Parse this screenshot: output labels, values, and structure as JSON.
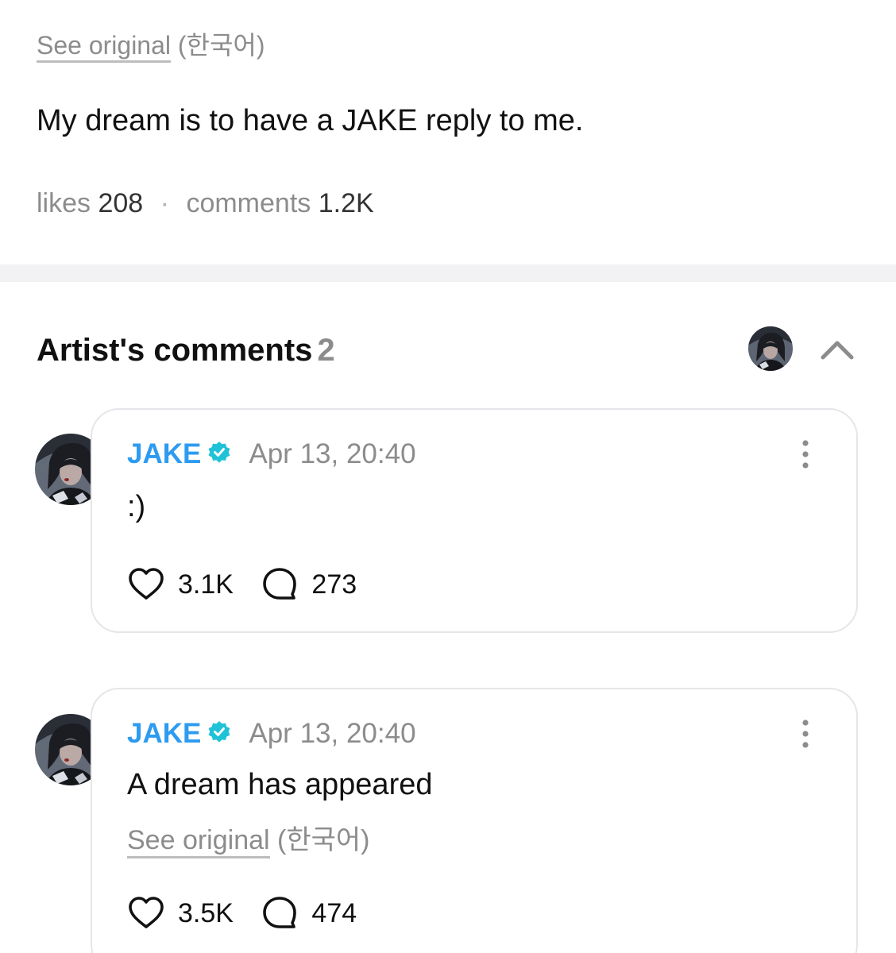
{
  "post": {
    "see_original_label": "See original",
    "language_note": "(한국어)",
    "text": "My dream is to have a JAKE reply to me.",
    "likes_label": "likes",
    "likes_count": "208",
    "separator": "·",
    "comments_label": "comments",
    "comments_count": "1.2K"
  },
  "artist_comments": {
    "title": "Artist's comments",
    "count": "2",
    "collapse_icon": "chevron-up-icon"
  },
  "comments": [
    {
      "author": "JAKE",
      "verified_icon": "verified-badge-icon",
      "timestamp": "Apr 13, 20:40",
      "text": ":)",
      "likes": "3.1K",
      "replies": "273"
    },
    {
      "author": "JAKE",
      "verified_icon": "verified-badge-icon",
      "timestamp": "Apr 13, 20:40",
      "text": "A dream has appeared",
      "see_original_label": "See original",
      "language_note": "(한국어)",
      "likes": "3.5K",
      "replies": "474"
    }
  ],
  "colors": {
    "author_blue": "#2d9bf0",
    "verified_teal": "#1fc2d6",
    "muted_text": "#8c8c8c",
    "card_border": "#e6e6ea"
  }
}
